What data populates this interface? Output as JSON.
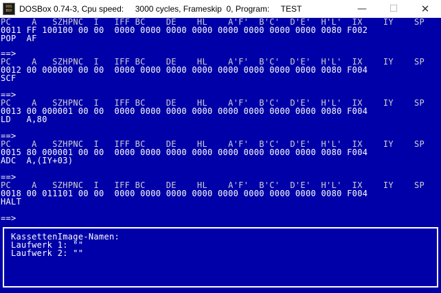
{
  "window": {
    "title": "DOSBox 0.74-3, Cpu speed:     3000 cycles, Frameskip  0, Program:     TEST",
    "icon_lines": [
      "DOS",
      "BOX"
    ],
    "minimize_glyph": "—",
    "maximize_glyph": "☐",
    "close_glyph": "✕"
  },
  "console": {
    "blocks": [
      {
        "header": "PC    A   SZHPNC  I   IFF BC    DE    HL    A'F'  B'C'  D'E'  H'L'  IX    IY    SP",
        "registers": "0011 FF 100100 00 00  0000 0000 0000 0000 0000 0000 0000 0000 0080 F002",
        "instruction": "POP  AF",
        "prompt": ""
      },
      {
        "header": "PC    A   SZHPNC  I   IFF BC    DE    HL    A'F'  B'C'  D'E'  H'L'  IX    IY    SP",
        "registers": "0012 00 000000 00 00  0000 0000 0000 0000 0000 0000 0000 0000 0080 F004",
        "instruction": "SCF",
        "prompt": "==>"
      },
      {
        "header": "PC    A   SZHPNC  I   IFF BC    DE    HL    A'F'  B'C'  D'E'  H'L'  IX    IY    SP",
        "registers": "0013 00 000001 00 00  0000 0000 0000 0000 0000 0000 0000 0000 0080 F004",
        "instruction": "LD   A,80",
        "prompt": "==>"
      },
      {
        "header": "PC    A   SZHPNC  I   IFF BC    DE    HL    A'F'  B'C'  D'E'  H'L'  IX    IY    SP",
        "registers": "0015 80 000001 00 00  0000 0000 0000 0000 0000 0000 0000 0000 0080 F004",
        "instruction": "ADC  A,(IY+03)",
        "prompt": "==>"
      },
      {
        "header": "PC    A   SZHPNC  I   IFF BC    DE    HL    A'F'  B'C'  D'E'  H'L'  IX    IY    SP",
        "registers": "0018 00 011101 00 00  0000 0000 0000 0000 0000 0000 0000 0000 0080 F004",
        "instruction": "HALT",
        "prompt": "==>"
      }
    ],
    "final_prompt": "==>"
  },
  "panel": {
    "title": "KassettenImage-Namen:",
    "lines": [
      "Laufwerk 1: \"\"",
      "Laufwerk 2: \"\""
    ]
  },
  "colors": {
    "background": "#0000a8",
    "text": "#ffffff",
    "titlebar": "#ffffff"
  }
}
